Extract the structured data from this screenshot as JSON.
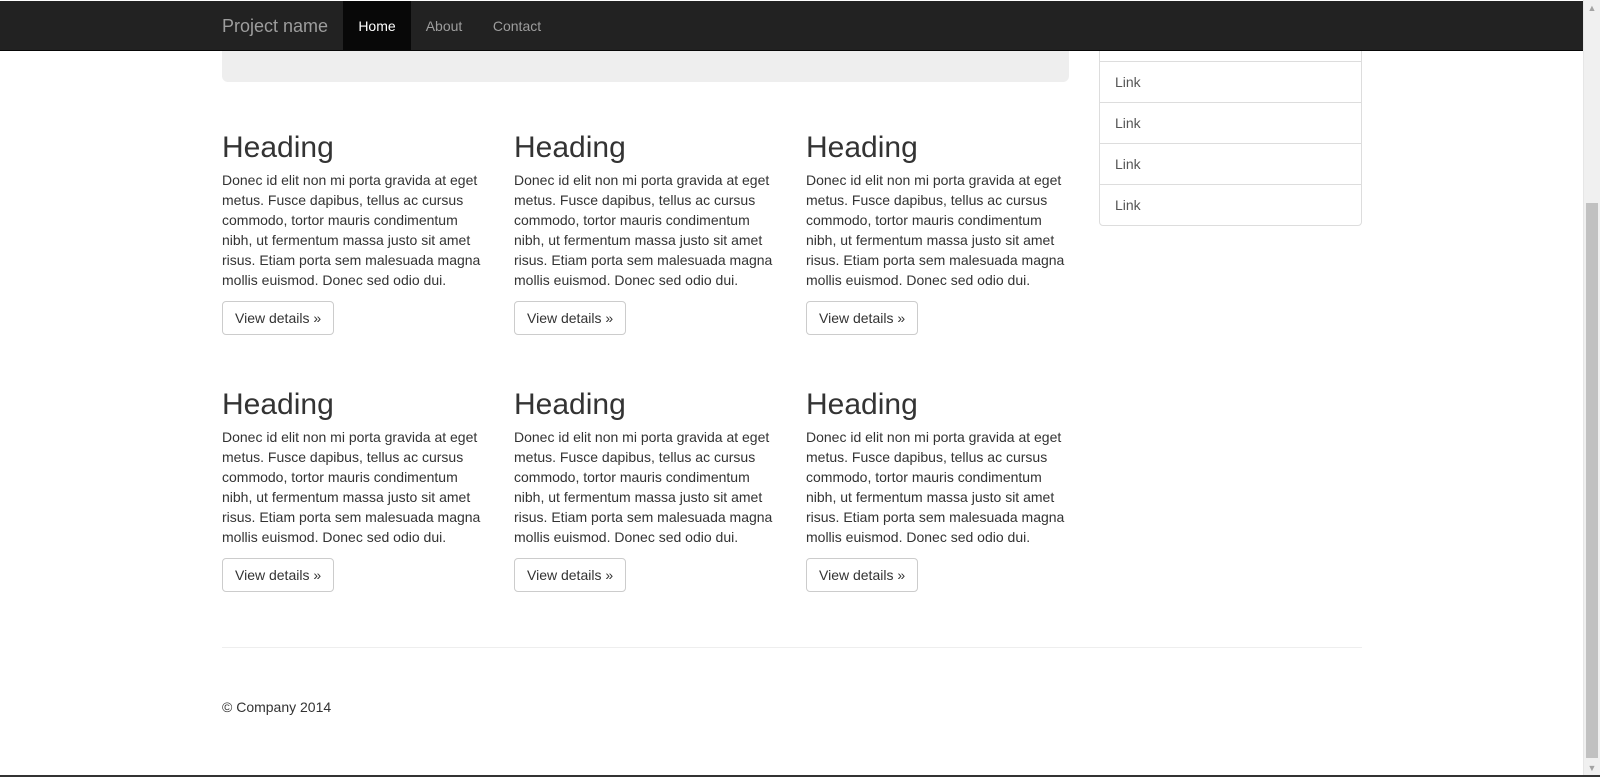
{
  "navbar": {
    "brand": "Project name",
    "items": [
      {
        "label": "Home",
        "active": true
      },
      {
        "label": "About",
        "active": false
      },
      {
        "label": "Contact",
        "active": false
      }
    ]
  },
  "columns": [
    {
      "heading": "Heading",
      "text": "Donec id elit non mi porta gravida at eget metus. Fusce dapibus, tellus ac cursus commodo, tortor mauris condimentum nibh, ut fermentum massa justo sit amet risus. Etiam porta sem malesuada magna mollis euismod. Donec sed odio dui.",
      "button": "View details »"
    },
    {
      "heading": "Heading",
      "text": "Donec id elit non mi porta gravida at eget metus. Fusce dapibus, tellus ac cursus commodo, tortor mauris condimentum nibh, ut fermentum massa justo sit amet risus. Etiam porta sem malesuada magna mollis euismod. Donec sed odio dui.",
      "button": "View details »"
    },
    {
      "heading": "Heading",
      "text": "Donec id elit non mi porta gravida at eget metus. Fusce dapibus, tellus ac cursus commodo, tortor mauris condimentum nibh, ut fermentum massa justo sit amet risus. Etiam porta sem malesuada magna mollis euismod. Donec sed odio dui.",
      "button": "View details »"
    },
    {
      "heading": "Heading",
      "text": "Donec id elit non mi porta gravida at eget metus. Fusce dapibus, tellus ac cursus commodo, tortor mauris condimentum nibh, ut fermentum massa justo sit amet risus. Etiam porta sem malesuada magna mollis euismod. Donec sed odio dui.",
      "button": "View details »"
    },
    {
      "heading": "Heading",
      "text": "Donec id elit non mi porta gravida at eget metus. Fusce dapibus, tellus ac cursus commodo, tortor mauris condimentum nibh, ut fermentum massa justo sit amet risus. Etiam porta sem malesuada magna mollis euismod. Donec sed odio dui.",
      "button": "View details »"
    },
    {
      "heading": "Heading",
      "text": "Donec id elit non mi porta gravida at eget metus. Fusce dapibus, tellus ac cursus commodo, tortor mauris condimentum nibh, ut fermentum massa justo sit amet risus. Etiam porta sem malesuada magna mollis euismod. Donec sed odio dui.",
      "button": "View details »"
    }
  ],
  "sidebar": {
    "links": [
      "Link",
      "Link",
      "Link",
      "Link"
    ]
  },
  "footer": {
    "text": "© Company 2014"
  },
  "scrollbar": {
    "up_icon": "scroll-up-arrow-icon",
    "down_icon": "scroll-down-arrow-icon"
  },
  "colors": {
    "navbar_bg": "#222222",
    "navbar_active_bg": "#080808",
    "jumbotron_bg": "#eeeeee",
    "text": "#333333"
  }
}
